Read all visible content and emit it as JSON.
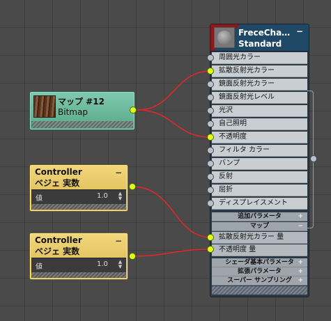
{
  "bitmap_node": {
    "title": "マップ #12",
    "subtitle": "Bitmap"
  },
  "controllers": [
    {
      "title": "Controller",
      "subtitle": "ベジェ 実数",
      "param_label": "値",
      "value": "1.0",
      "collapse_symbol": "−"
    },
    {
      "title": "Controller",
      "subtitle": "ベジェ 実数",
      "param_label": "値",
      "value": "1.0",
      "collapse_symbol": "−"
    }
  ],
  "material_node": {
    "title": "FreceCha…",
    "subtitle": "Standard",
    "collapse_symbol": "−",
    "slots": [
      "周囲光カラー",
      "拡散反射光カラー",
      "鏡面反射光カラー",
      "鏡面反射光レベル",
      "光沢",
      "自己照明",
      "不透明度",
      "フィルタ カラー",
      "バンプ",
      "反射",
      "屈折",
      "ディスプレイスメント"
    ],
    "section_additional": {
      "label": "追加パラメータ",
      "symbol": "+"
    },
    "section_maps": {
      "label": "マップ",
      "symbol": "−"
    },
    "map_slots": [
      "拡散反射光カラー 量",
      "不透明度 量"
    ],
    "section_shader": {
      "label": "シェーダ基本パラメータ",
      "symbol": "+"
    },
    "section_extended": {
      "label": "拡張パラメータ",
      "symbol": "+"
    },
    "section_supersampling": {
      "label": "スーパー サンプリング",
      "symbol": "+"
    }
  },
  "colors": {
    "background": "#4a4a4a",
    "wire": "#e8262a",
    "socket_connected": "#dfff1a",
    "socket_idle": "#b9c2ca",
    "bitmap_node": "#6bb89c",
    "controller_node": "#e8c862",
    "material_header_red": "#8c1a1a",
    "material_header_blue": "#1f4866"
  }
}
